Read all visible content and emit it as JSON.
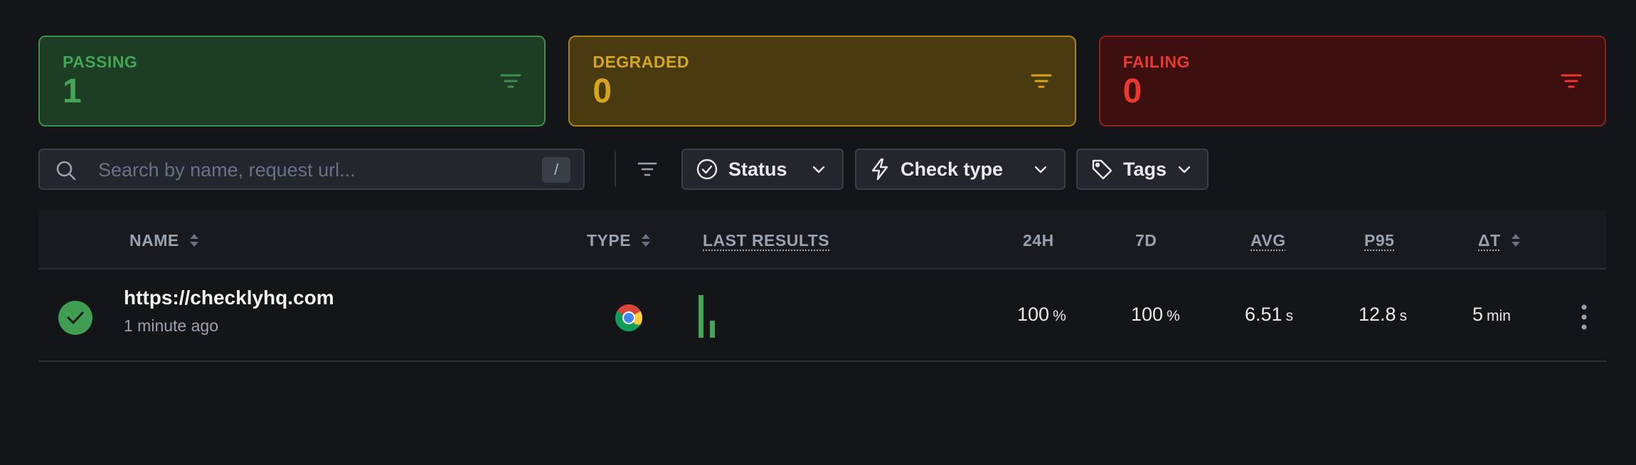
{
  "summary": {
    "passing": {
      "label": "PASSING",
      "count": "1"
    },
    "degraded": {
      "label": "DEGRADED",
      "count": "0"
    },
    "failing": {
      "label": "FAILING",
      "count": "0"
    }
  },
  "toolbar": {
    "search_placeholder": "Search by name, request url...",
    "search_shortcut": "/",
    "filters": [
      {
        "label": "Status",
        "icon": "check-circle-icon"
      },
      {
        "label": "Check type",
        "icon": "lightning-icon"
      },
      {
        "label": "Tags",
        "icon": "tag-icon"
      }
    ]
  },
  "table": {
    "columns": {
      "name": "NAME",
      "type": "TYPE",
      "last_results": "LAST RESULTS",
      "h24": "24H",
      "d7": "7D",
      "avg": "AVG",
      "p95": "P95",
      "dt": "ΔT"
    },
    "rows": [
      {
        "status": "passing",
        "name": "https://checklyhq.com",
        "updated": "1 minute ago",
        "type_icon": "chrome-icon",
        "last_results": [
          1.0,
          0.4
        ],
        "h24": {
          "value": "100",
          "unit": "%"
        },
        "d7": {
          "value": "100",
          "unit": "%"
        },
        "avg": {
          "value": "6.51",
          "unit": "s"
        },
        "p95": {
          "value": "12.8",
          "unit": "s"
        },
        "dt": {
          "value": "5",
          "unit": "min"
        }
      }
    ]
  },
  "colors": {
    "passing": "#45a556",
    "degraded": "#d6a51e",
    "failing": "#e8382f",
    "background": "#141519"
  }
}
